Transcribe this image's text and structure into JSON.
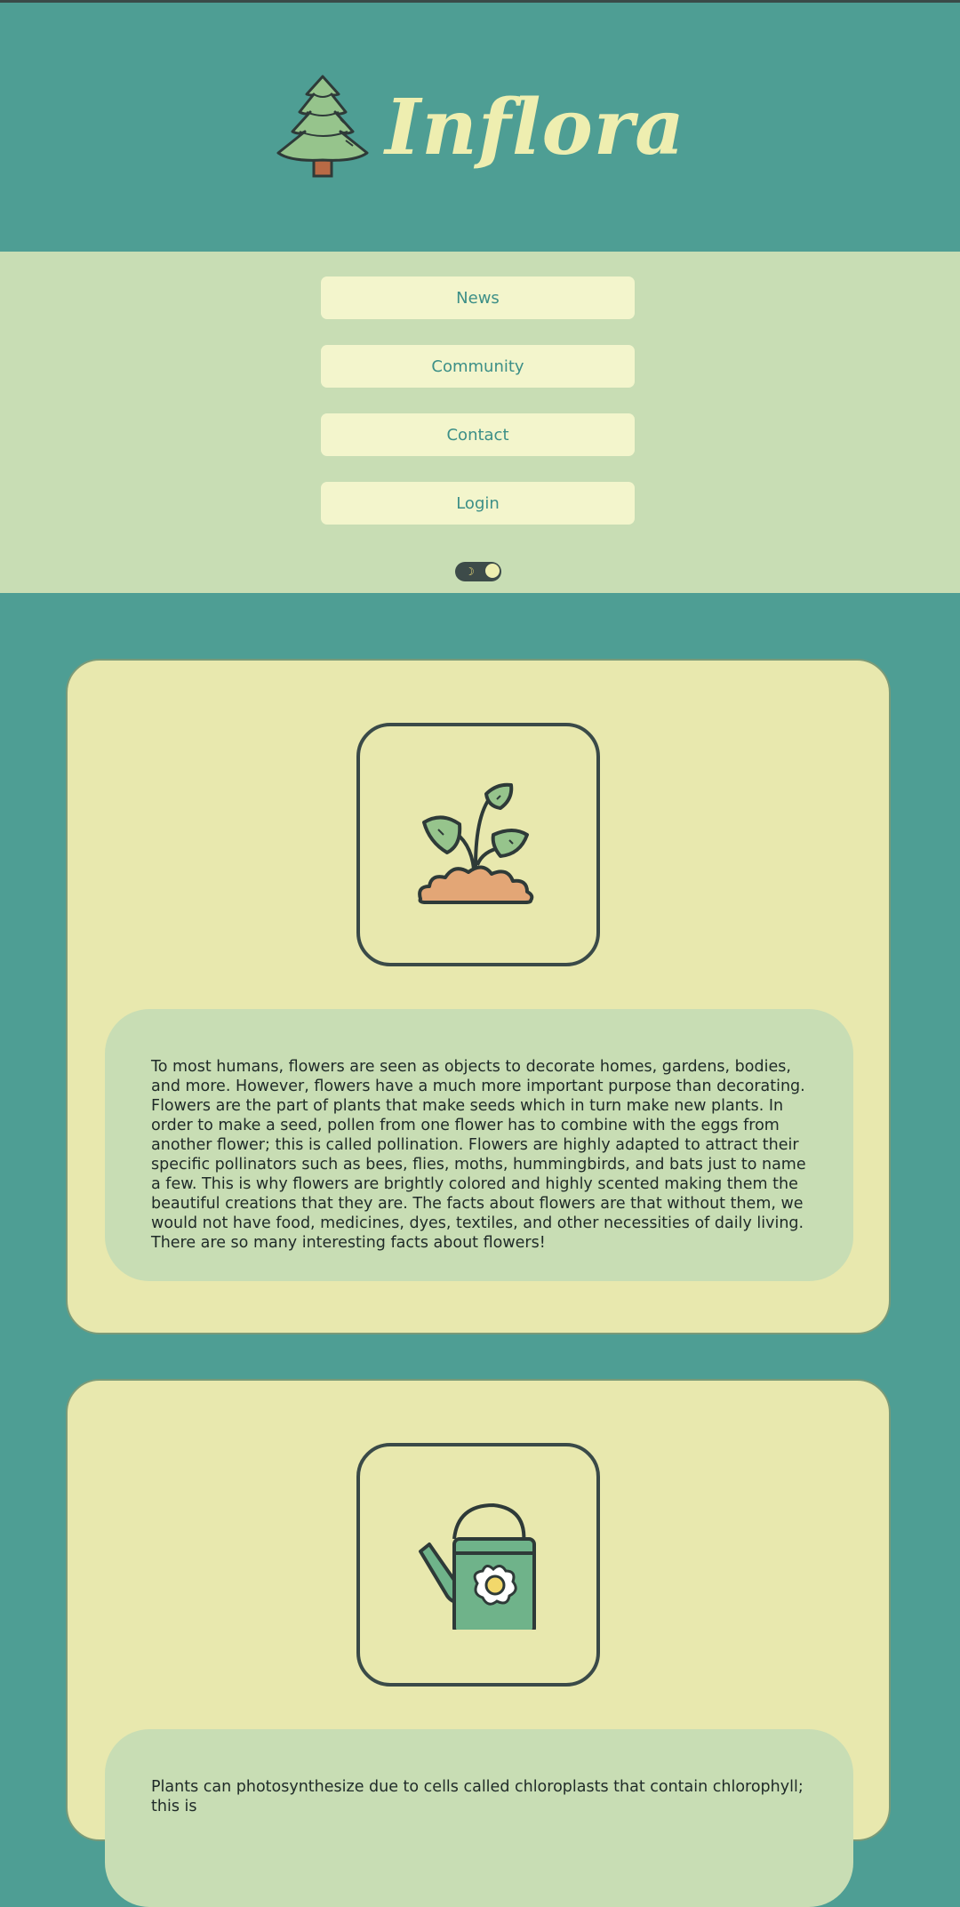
{
  "header": {
    "title": "Inflora",
    "logo_icon": "pine-tree-icon"
  },
  "nav": {
    "items": [
      {
        "label": "News"
      },
      {
        "label": "Community"
      },
      {
        "label": "Contact"
      },
      {
        "label": "Login"
      }
    ],
    "theme_toggle": {
      "icon": "moon-icon",
      "state": "light"
    }
  },
  "cards": [
    {
      "icon": "sprout-icon",
      "text": "To most humans, flowers are seen as objects to decorate homes, gardens, bodies, and more. However, flowers have a much more important purpose than decorating. Flowers are the part of plants that make seeds which in turn make new plants. In order to make a seed, pollen from one flower has to combine with the eggs from another flower; this is called pollination. Flowers are highly adapted to attract their specific pollinators such as bees, flies, moths, hummingbirds, and bats just to name a few. This is why flowers are brightly colored and highly scented making them the beautiful creations that they are. The facts about flowers are that without them, we would not have food, medicines, dyes, textiles, and other necessities of daily living. There are so many interesting facts about flowers!"
    },
    {
      "icon": "watering-can-icon",
      "text": "Plants can photosynthesize due to cells called chloroplasts that contain chlorophyll; this is"
    }
  ],
  "colors": {
    "teal": "#4e9e94",
    "sage": "#c8ddb4",
    "cream": "#e8e8ae",
    "dark": "#3a4a48"
  }
}
